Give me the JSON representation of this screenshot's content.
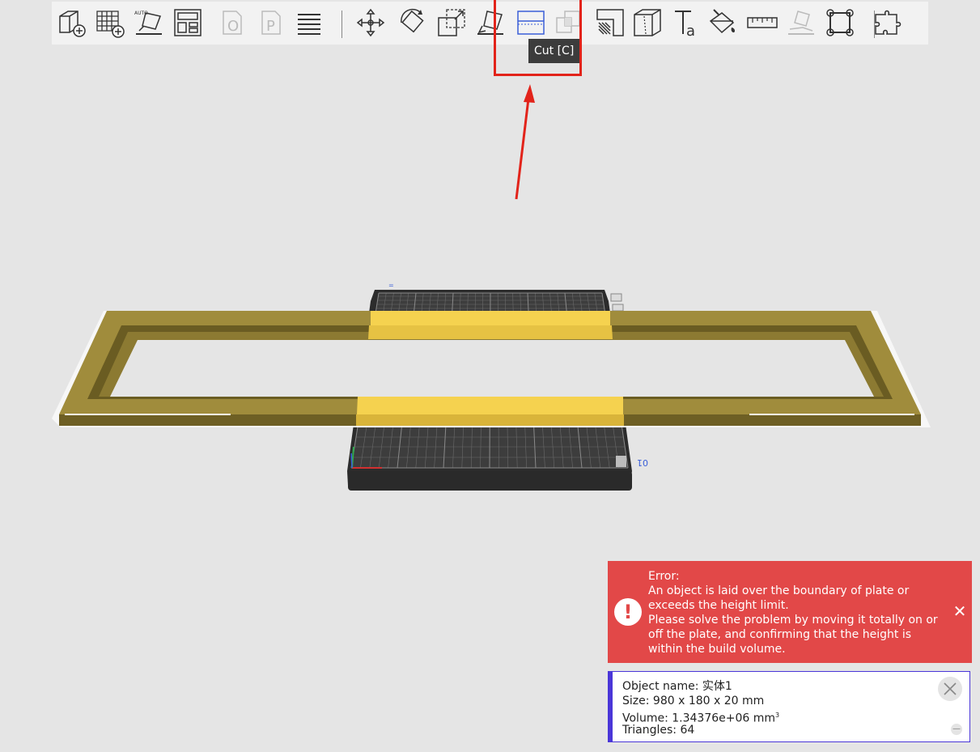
{
  "toolbar": {
    "buttons": [
      {
        "icon": "add-object-icon",
        "tooltip": "",
        "enabled": true
      },
      {
        "icon": "add-plate-icon",
        "tooltip": "",
        "enabled": true
      },
      {
        "icon": "auto-orient-icon",
        "tooltip": "",
        "enabled": true
      },
      {
        "icon": "arrange-icon",
        "tooltip": "",
        "enabled": true
      },
      {
        "icon": "split-to-objects-icon",
        "tooltip": "",
        "enabled": false
      },
      {
        "icon": "split-to-parts-icon",
        "tooltip": "",
        "enabled": false
      },
      {
        "icon": "layers-icon",
        "tooltip": "",
        "enabled": true
      },
      {
        "icon": "move-icon",
        "tooltip": "",
        "enabled": true
      },
      {
        "icon": "rotate-icon",
        "tooltip": "",
        "enabled": true
      },
      {
        "icon": "scale-icon",
        "tooltip": "",
        "enabled": true
      },
      {
        "icon": "lay-on-face-icon",
        "tooltip": "",
        "enabled": true
      },
      {
        "icon": "cut-icon",
        "tooltip": "Cut [C]",
        "enabled": true,
        "active": true
      },
      {
        "icon": "mesh-boolean-icon",
        "tooltip": "",
        "enabled": false
      },
      {
        "icon": "support-painting-icon",
        "tooltip": "",
        "enabled": true
      },
      {
        "icon": "seam-painting-icon",
        "tooltip": "",
        "enabled": true
      },
      {
        "icon": "text-shape-icon",
        "tooltip": "",
        "enabled": true
      },
      {
        "icon": "color-painting-icon",
        "tooltip": "",
        "enabled": true
      },
      {
        "icon": "measure-icon",
        "tooltip": "",
        "enabled": true
      },
      {
        "icon": "assembly-icon",
        "tooltip": "",
        "enabled": false
      },
      {
        "icon": "brim-ears-icon",
        "tooltip": "",
        "enabled": true
      },
      {
        "icon": "assembly-view-icon",
        "tooltip": "",
        "enabled": true
      }
    ],
    "tooltip_text": "Cut [C]"
  },
  "viewport": {
    "plate_label": "01",
    "object_color": "#a08c3c",
    "selected_color": "#f5d24f",
    "plate_color": "#2c2c2c"
  },
  "notification": {
    "type": "error",
    "title": "Error:",
    "message": "An object is laid over the boundary of plate or\nexceeds the height limit.\nPlease solve the problem by moving it totally on or\noff the plate, and confirming that the height is\nwithin the build volume.",
    "icon": "exclamation-icon",
    "color": "#e24848"
  },
  "object_info": {
    "name_label": "Object name: 实体1",
    "size_label": "Size: 980 x 180 x 20 mm",
    "volume_label": "Volume: 1.34376e+06 mm",
    "volume_unit_sup": "3",
    "triangles_label": "Triangles: 64"
  }
}
